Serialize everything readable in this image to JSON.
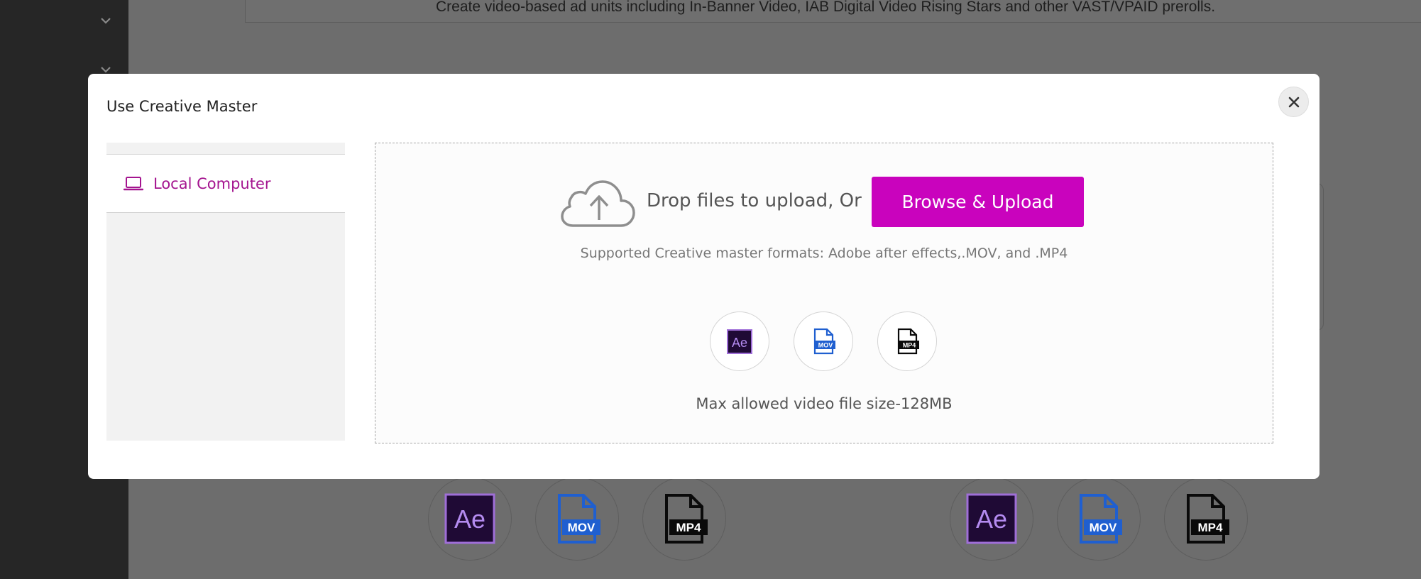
{
  "background": {
    "description_line": "Create video-based ad units including In-Banner Video, IAB Digital Video Rising Stars and other VAST/VPAID prerolls.",
    "format_icons": [
      {
        "label": "Ae",
        "icon": "after-effects-icon"
      },
      {
        "label": "MOV",
        "icon": "mov-file-icon"
      },
      {
        "label": "MP4",
        "icon": "mp4-file-icon"
      },
      {
        "label": "Ae",
        "icon": "after-effects-icon"
      },
      {
        "label": "MOV",
        "icon": "mov-file-icon"
      },
      {
        "label": "MP4",
        "icon": "mp4-file-icon"
      }
    ]
  },
  "modal": {
    "title": "Use Creative Master",
    "close_icon": "close-icon",
    "sources": [
      {
        "label": "Local Computer",
        "icon": "laptop-icon",
        "active": true
      }
    ],
    "upload": {
      "drop_text": "Drop files to upload, Or",
      "browse_label": "Browse & Upload",
      "formats_text": "Supported Creative master formats: Adobe after effects,.MOV, and .MP4",
      "format_icons": [
        {
          "label": "Ae",
          "icon": "after-effects-icon"
        },
        {
          "label": "MOV",
          "icon": "mov-file-icon"
        },
        {
          "label": "MP4",
          "icon": "mp4-file-icon"
        }
      ],
      "max_size_text": "Max allowed video file size-128MB"
    }
  },
  "colors": {
    "accent": "#c903bd",
    "accent_text": "#a4148f",
    "overlay": "#6d6d6d",
    "sidebar": "#262626",
    "ae_bg": "#1f0a35",
    "ae_border": "#9f6ed8",
    "mov_blue": "#1f5fd0"
  }
}
